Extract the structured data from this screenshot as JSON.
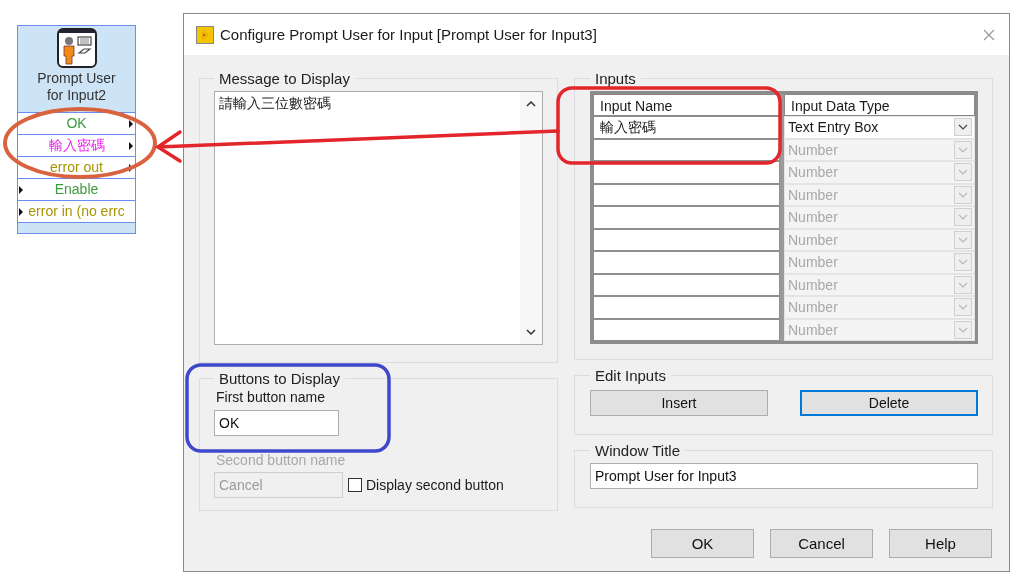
{
  "node": {
    "title": "Prompt User for Input2",
    "terminals": [
      {
        "label": "OK",
        "kind": "output",
        "color": "#3c9c3c"
      },
      {
        "label": "輸入密碼",
        "kind": "output",
        "color": "#f020f0"
      },
      {
        "label": "error out",
        "kind": "output",
        "color": "#a89400"
      },
      {
        "label": "Enable",
        "kind": "input",
        "color": "#3c9c3c"
      },
      {
        "label": "error in (no errc",
        "kind": "input",
        "color": "#a89400"
      }
    ]
  },
  "dialog": {
    "title": "Configure Prompt User for Input [Prompt User for Input3]",
    "message_group": {
      "label": "Message to Display",
      "value": "請輸入三位數密碼"
    },
    "buttons_group": {
      "label": "Buttons to Display",
      "first_label": "First button name",
      "first_value": "OK",
      "second_label": "Second button name",
      "second_value": "Cancel",
      "second_disabled": true,
      "checkbox_label": "Display second button",
      "checked": false
    },
    "inputs_group": {
      "label": "Inputs",
      "columns": [
        "Input Name",
        "Input Data Type"
      ],
      "rows": [
        {
          "name": "輸入密碼",
          "type": "Text Entry Box",
          "disabled": false
        },
        {
          "type": "Number",
          "disabled": true
        },
        {
          "type": "Number",
          "disabled": true
        },
        {
          "type": "Number",
          "disabled": true
        },
        {
          "type": "Number",
          "disabled": true
        },
        {
          "type": "Number",
          "disabled": true
        },
        {
          "type": "Number",
          "disabled": true
        },
        {
          "type": "Number",
          "disabled": true
        },
        {
          "type": "Number",
          "disabled": true
        },
        {
          "type": "Number",
          "disabled": true
        }
      ]
    },
    "edit_group": {
      "label": "Edit Inputs",
      "buttons": [
        {
          "label": "Insert",
          "focused": false
        },
        {
          "label": "Delete",
          "focused": true
        }
      ]
    },
    "window_title_group": {
      "label": "Window Title",
      "value": "Prompt User for Input3"
    },
    "footer_buttons": [
      "OK",
      "Cancel",
      "Help"
    ]
  },
  "annotations": [
    {
      "kind": "ellipse",
      "color": "#d9623f"
    },
    {
      "kind": "arrow",
      "color": "#e3262b"
    },
    {
      "kind": "rounded_rect",
      "color": "#e3262b"
    },
    {
      "kind": "rounded_rect",
      "color": "#3f48cc"
    }
  ]
}
